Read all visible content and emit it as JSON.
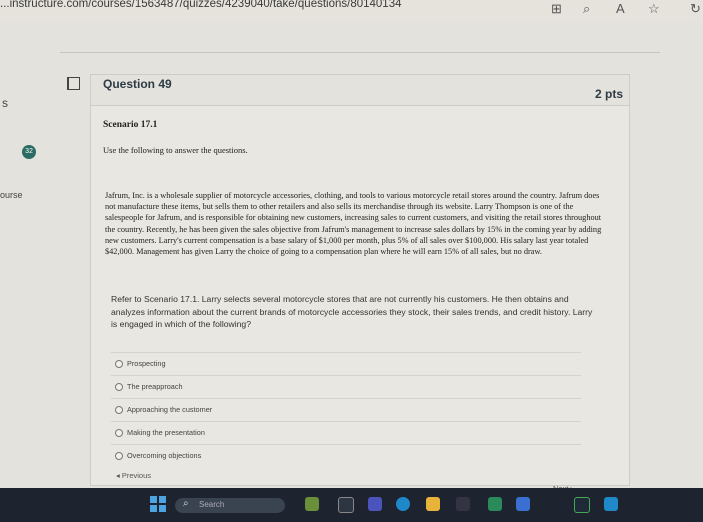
{
  "browser": {
    "url": "...instructure.com/courses/1563487/quizzes/4239040/take/questions/80140134"
  },
  "sidebar": {
    "partial_text_1": "s",
    "badge_count": "32",
    "partial_text_2": "ourse"
  },
  "question": {
    "title": "Question 49",
    "points": "2 pts",
    "scenario_title": "Scenario 17.1",
    "scenario_intro": "Use the following to answer the questions.",
    "scenario_body": "Jafrum, Inc. is a wholesale supplier of motorcycle accessories, clothing, and tools to various motorcycle retail stores around the country. Jafrum does not manufacture these items, but sells them to other retailers and also sells its merchandise through its website. Larry Thompson is one of the salespeople for Jafrum, and is responsible for obtaining new customers, increasing sales to current customers, and visiting the retail stores throughout the country. Recently, he has been given the sales objective from Jafrum's management to increase sales dollars by 15% in the coming year by adding new customers. Larry's current compensation is a base salary of $1,000 per month, plus 5% of all sales over $100,000. His salary last year totaled $42,000. Management has given Larry the choice of going to a compensation plan where he will earn 15% of all sales, but no draw.",
    "prompt": "Refer to Scenario 17.1. Larry selects several motorcycle stores that are not currently his customers. He then obtains and analyzes information about the current brands of motorcycle accessories they stock, their sales trends, and credit history. Larry is engaged in which of the following?",
    "answers": [
      "Prospecting",
      "The preapproach",
      "Approaching the customer",
      "Making the presentation",
      "Overcoming objections"
    ]
  },
  "nav": {
    "previous_label": "◂ Previous",
    "next_label": "Next ▸"
  },
  "taskbar": {
    "search_placeholder": "Search"
  },
  "colors": {
    "badge": "#2a6b63",
    "taskbar": "#1d2430"
  }
}
